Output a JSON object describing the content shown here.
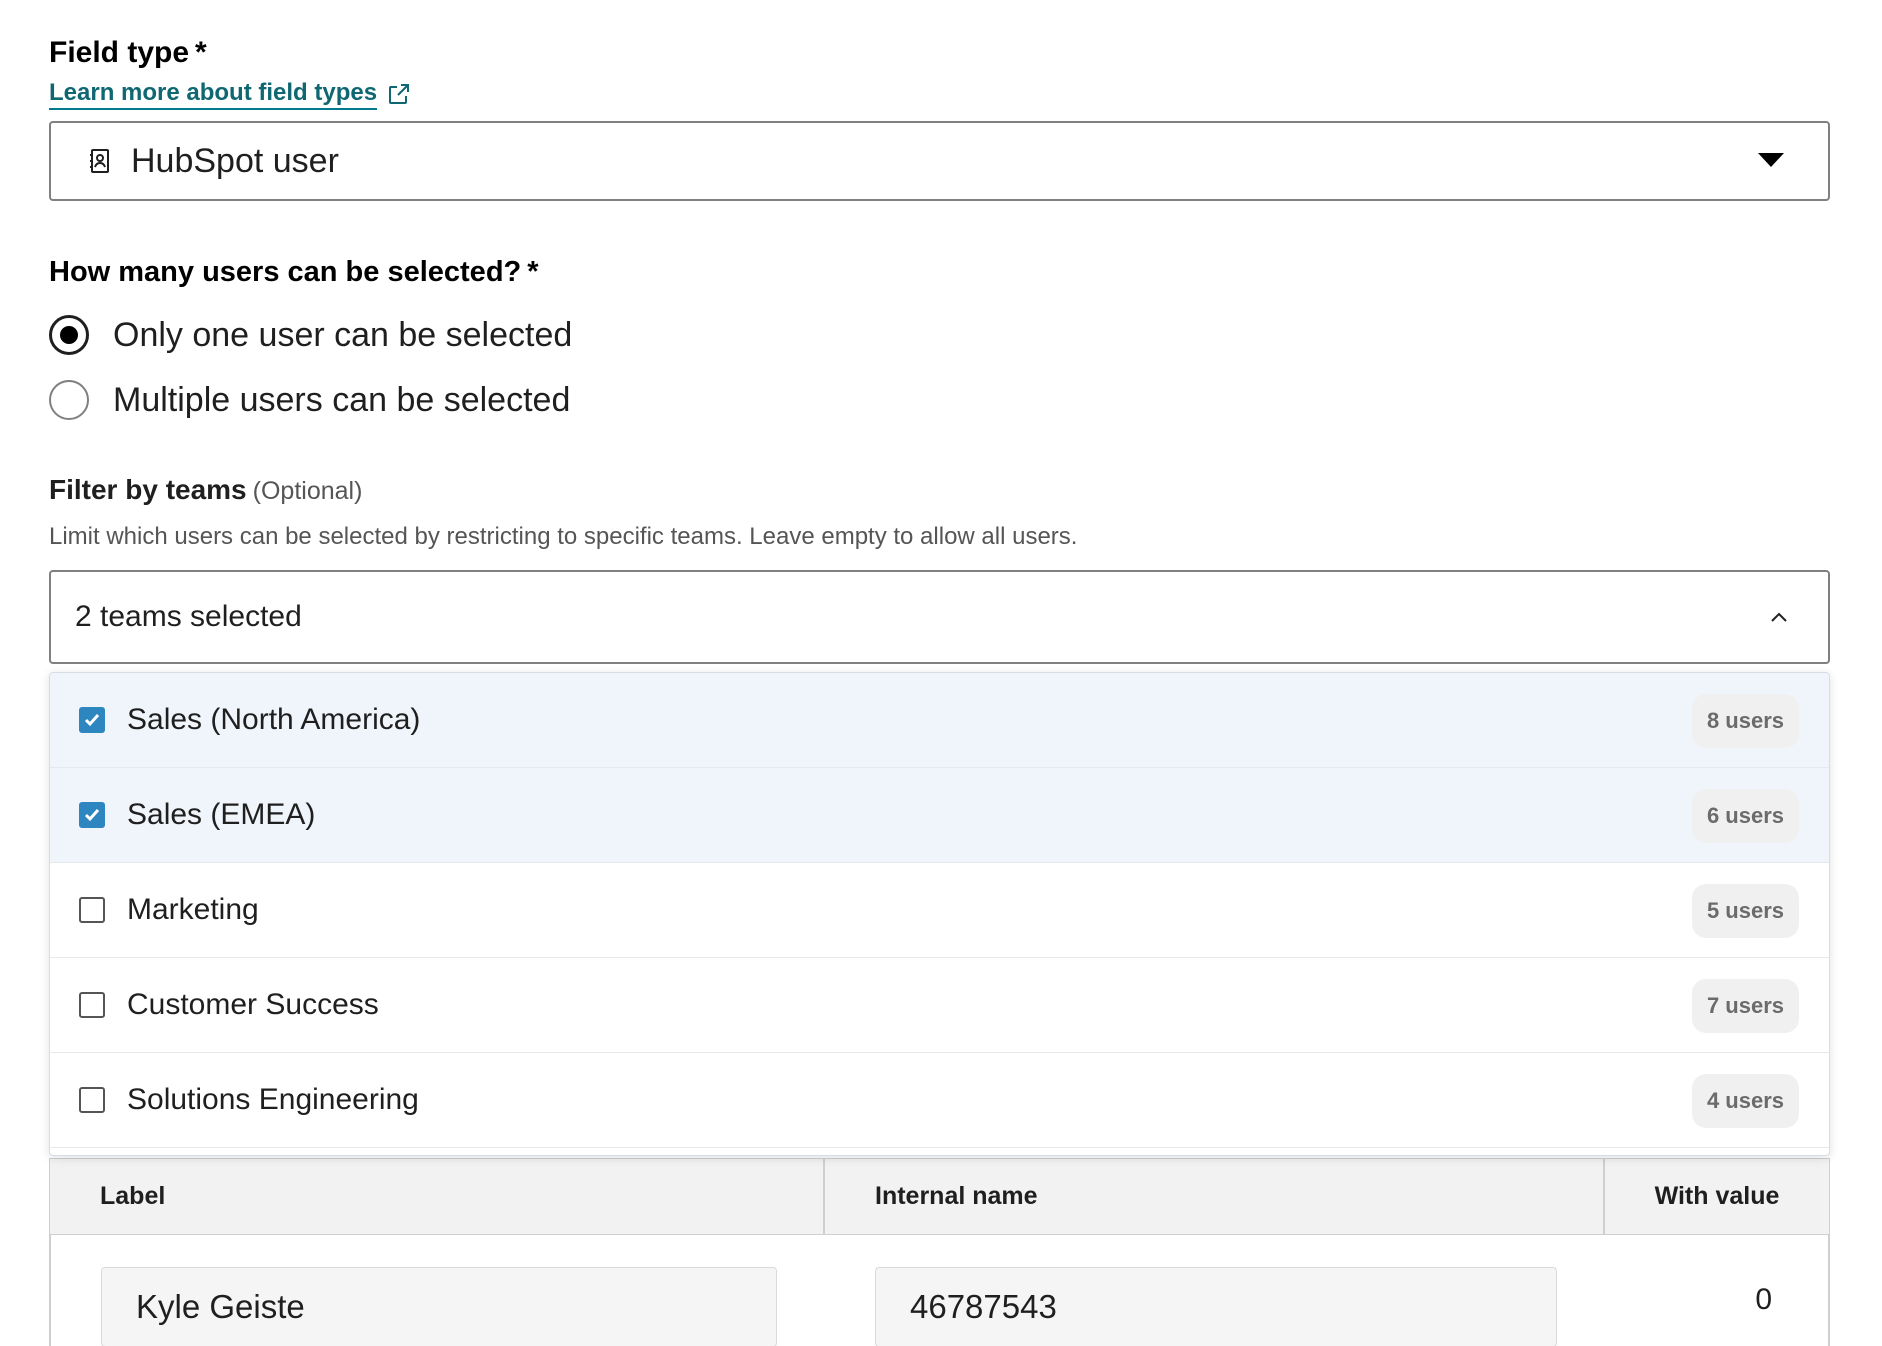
{
  "field_type": {
    "label": "Field type",
    "required_mark": "*",
    "learn_more": "Learn more about field types",
    "selected": "HubSpot user",
    "icon": "contact-card-icon"
  },
  "users_selection": {
    "question": "How many users can be selected?",
    "required_mark": "*",
    "options": [
      {
        "label": "Only one user can be selected",
        "checked": true
      },
      {
        "label": "Multiple users can be selected",
        "checked": false
      }
    ]
  },
  "filter_teams": {
    "label": "Filter by teams",
    "optional": "(Optional)",
    "help": "Limit which users can be selected by restricting to specific teams. Leave empty to allow all users.",
    "selected_summary": "2 teams selected",
    "options": [
      {
        "label": "Sales (North America)",
        "count": "8 users",
        "checked": true
      },
      {
        "label": "Sales (EMEA)",
        "count": "6 users",
        "checked": true
      },
      {
        "label": "Marketing",
        "count": "5 users",
        "checked": false
      },
      {
        "label": "Customer Success",
        "count": "7 users",
        "checked": false
      },
      {
        "label": "Solutions Engineering",
        "count": "4 users",
        "checked": false
      }
    ]
  },
  "table": {
    "headers": {
      "label": "Label",
      "internal_name": "Internal name",
      "with_value": "With value"
    },
    "rows": [
      {
        "label": "Kyle Geiste",
        "internal_name": "46787543",
        "with_value": "0"
      }
    ]
  },
  "colors": {
    "link": "#0f6772",
    "checkbox": "#2e86c1",
    "selected_row": "#f0f5fb"
  }
}
